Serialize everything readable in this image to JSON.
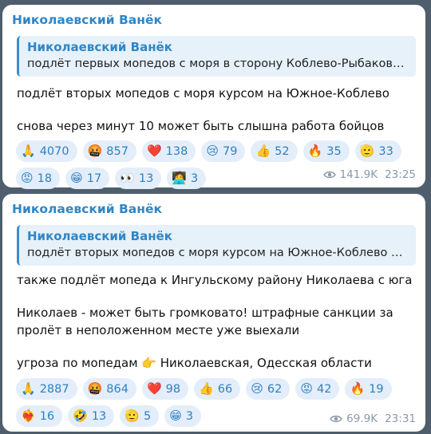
{
  "messages": [
    {
      "author": "Николаевский Ванёк",
      "quote": {
        "author": "Николаевский Ванёк",
        "text": "подлёт первых мопедов с моря в сторону Коблево-Рыбаковк..."
      },
      "paragraphs": [
        "подлёт вторых мопедов с моря курсом на Южное-Коблево",
        "снова через минут 10 может быть слышна работа бойцов"
      ],
      "reactions": [
        {
          "emoji": "🙏",
          "icon": "pray-icon",
          "count": "4070"
        },
        {
          "emoji": "🤬",
          "icon": "cursing-face-icon",
          "count": "857"
        },
        {
          "emoji": "❤️",
          "icon": "heart-icon",
          "count": "138"
        },
        {
          "emoji": "😢",
          "icon": "crying-face-icon",
          "count": "79"
        },
        {
          "emoji": "👍",
          "icon": "thumbs-up-icon",
          "count": "52"
        },
        {
          "emoji": "🔥",
          "icon": "fire-icon",
          "count": "35"
        },
        {
          "emoji": "🫡",
          "icon": "saluting-face-icon",
          "count": "33"
        },
        {
          "emoji": "😡",
          "icon": "angry-face-icon",
          "count": "18"
        },
        {
          "emoji": "😁",
          "icon": "grinning-face-icon",
          "count": "17"
        },
        {
          "emoji": "👀",
          "icon": "eyes-icon",
          "count": "13"
        },
        {
          "emoji": "🧑‍💻",
          "icon": "technologist-icon",
          "count": "3"
        }
      ],
      "views": "141.9K",
      "time": "23:25"
    },
    {
      "author": "Николаевский Ванёк",
      "quote": {
        "author": "Николаевский Ванёк",
        "text": "подлёт вторых мопедов с моря курсом на Южное-Коблево  с..."
      },
      "paragraphs": [
        "также подлёт мопеда к Ингульскому району Николаева с юга",
        "Николаев - может быть громковато! штрафные санкции за пролёт в неположенном месте уже выехали",
        "угроза по мопедам 👉 Николаевская, Одесская области"
      ],
      "reactions": [
        {
          "emoji": "🙏",
          "icon": "pray-icon",
          "count": "2887"
        },
        {
          "emoji": "🤬",
          "icon": "cursing-face-icon",
          "count": "864"
        },
        {
          "emoji": "❤️",
          "icon": "heart-icon",
          "count": "98"
        },
        {
          "emoji": "👍",
          "icon": "thumbs-up-icon",
          "count": "66"
        },
        {
          "emoji": "😢",
          "icon": "crying-face-icon",
          "count": "62"
        },
        {
          "emoji": "😡",
          "icon": "angry-face-icon",
          "count": "42"
        },
        {
          "emoji": "🔥",
          "icon": "fire-icon",
          "count": "19"
        },
        {
          "emoji": "❤️‍🔥",
          "icon": "heart-on-fire-icon",
          "count": "16"
        },
        {
          "emoji": "🤣",
          "icon": "rolling-laughing-icon",
          "count": "13"
        },
        {
          "emoji": "🫡",
          "icon": "saluting-face-icon",
          "count": "5"
        },
        {
          "emoji": "😁",
          "icon": "grinning-face-icon",
          "count": "3"
        }
      ],
      "views": "69.9K",
      "time": "23:31"
    }
  ],
  "colors": {
    "background": "#4f5e6c",
    "bubble": "#ffffff",
    "accent": "#2f86c6",
    "reaction_bg": "#e3eefa",
    "meta": "#8a98a6"
  }
}
